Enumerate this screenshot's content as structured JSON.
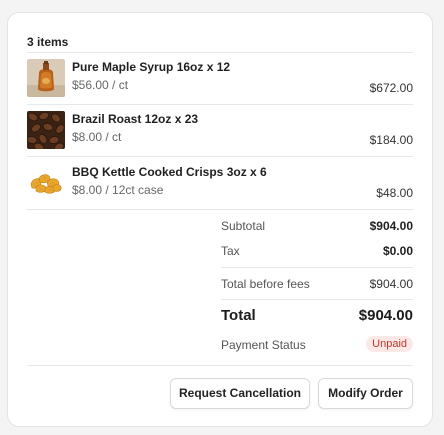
{
  "order": {
    "items_count_label": "3 items",
    "items": [
      {
        "name": "Pure Maple Syrup 16oz x 12",
        "unit_price": "$56.00 / ct",
        "line_total": "$672.00",
        "thumb_icon": "maple-syrup-bottle-image"
      },
      {
        "name": "Brazil Roast 12oz x 23",
        "unit_price": "$8.00 / ct",
        "line_total": "$184.00",
        "thumb_icon": "coffee-beans-image"
      },
      {
        "name": "BBQ Kettle Cooked Crisps 3oz x 6",
        "unit_price": "$8.00 / 12ct case",
        "line_total": "$48.00",
        "thumb_icon": "potato-chips-image"
      }
    ],
    "summary": {
      "subtotal_label": "Subtotal",
      "subtotal_value": "$904.00",
      "tax_label": "Tax",
      "tax_value": "$0.00",
      "before_fees_label": "Total before fees",
      "before_fees_value": "$904.00",
      "total_label": "Total",
      "total_value": "$904.00",
      "payment_status_label": "Payment Status",
      "payment_status_value": "Unpaid"
    },
    "actions": {
      "request_cancellation_label": "Request Cancellation",
      "modify_order_label": "Modify Order"
    }
  },
  "colors": {
    "badge_bg": "#fde8e8",
    "badge_text": "#c0392b",
    "border": "#e3e3e3"
  }
}
